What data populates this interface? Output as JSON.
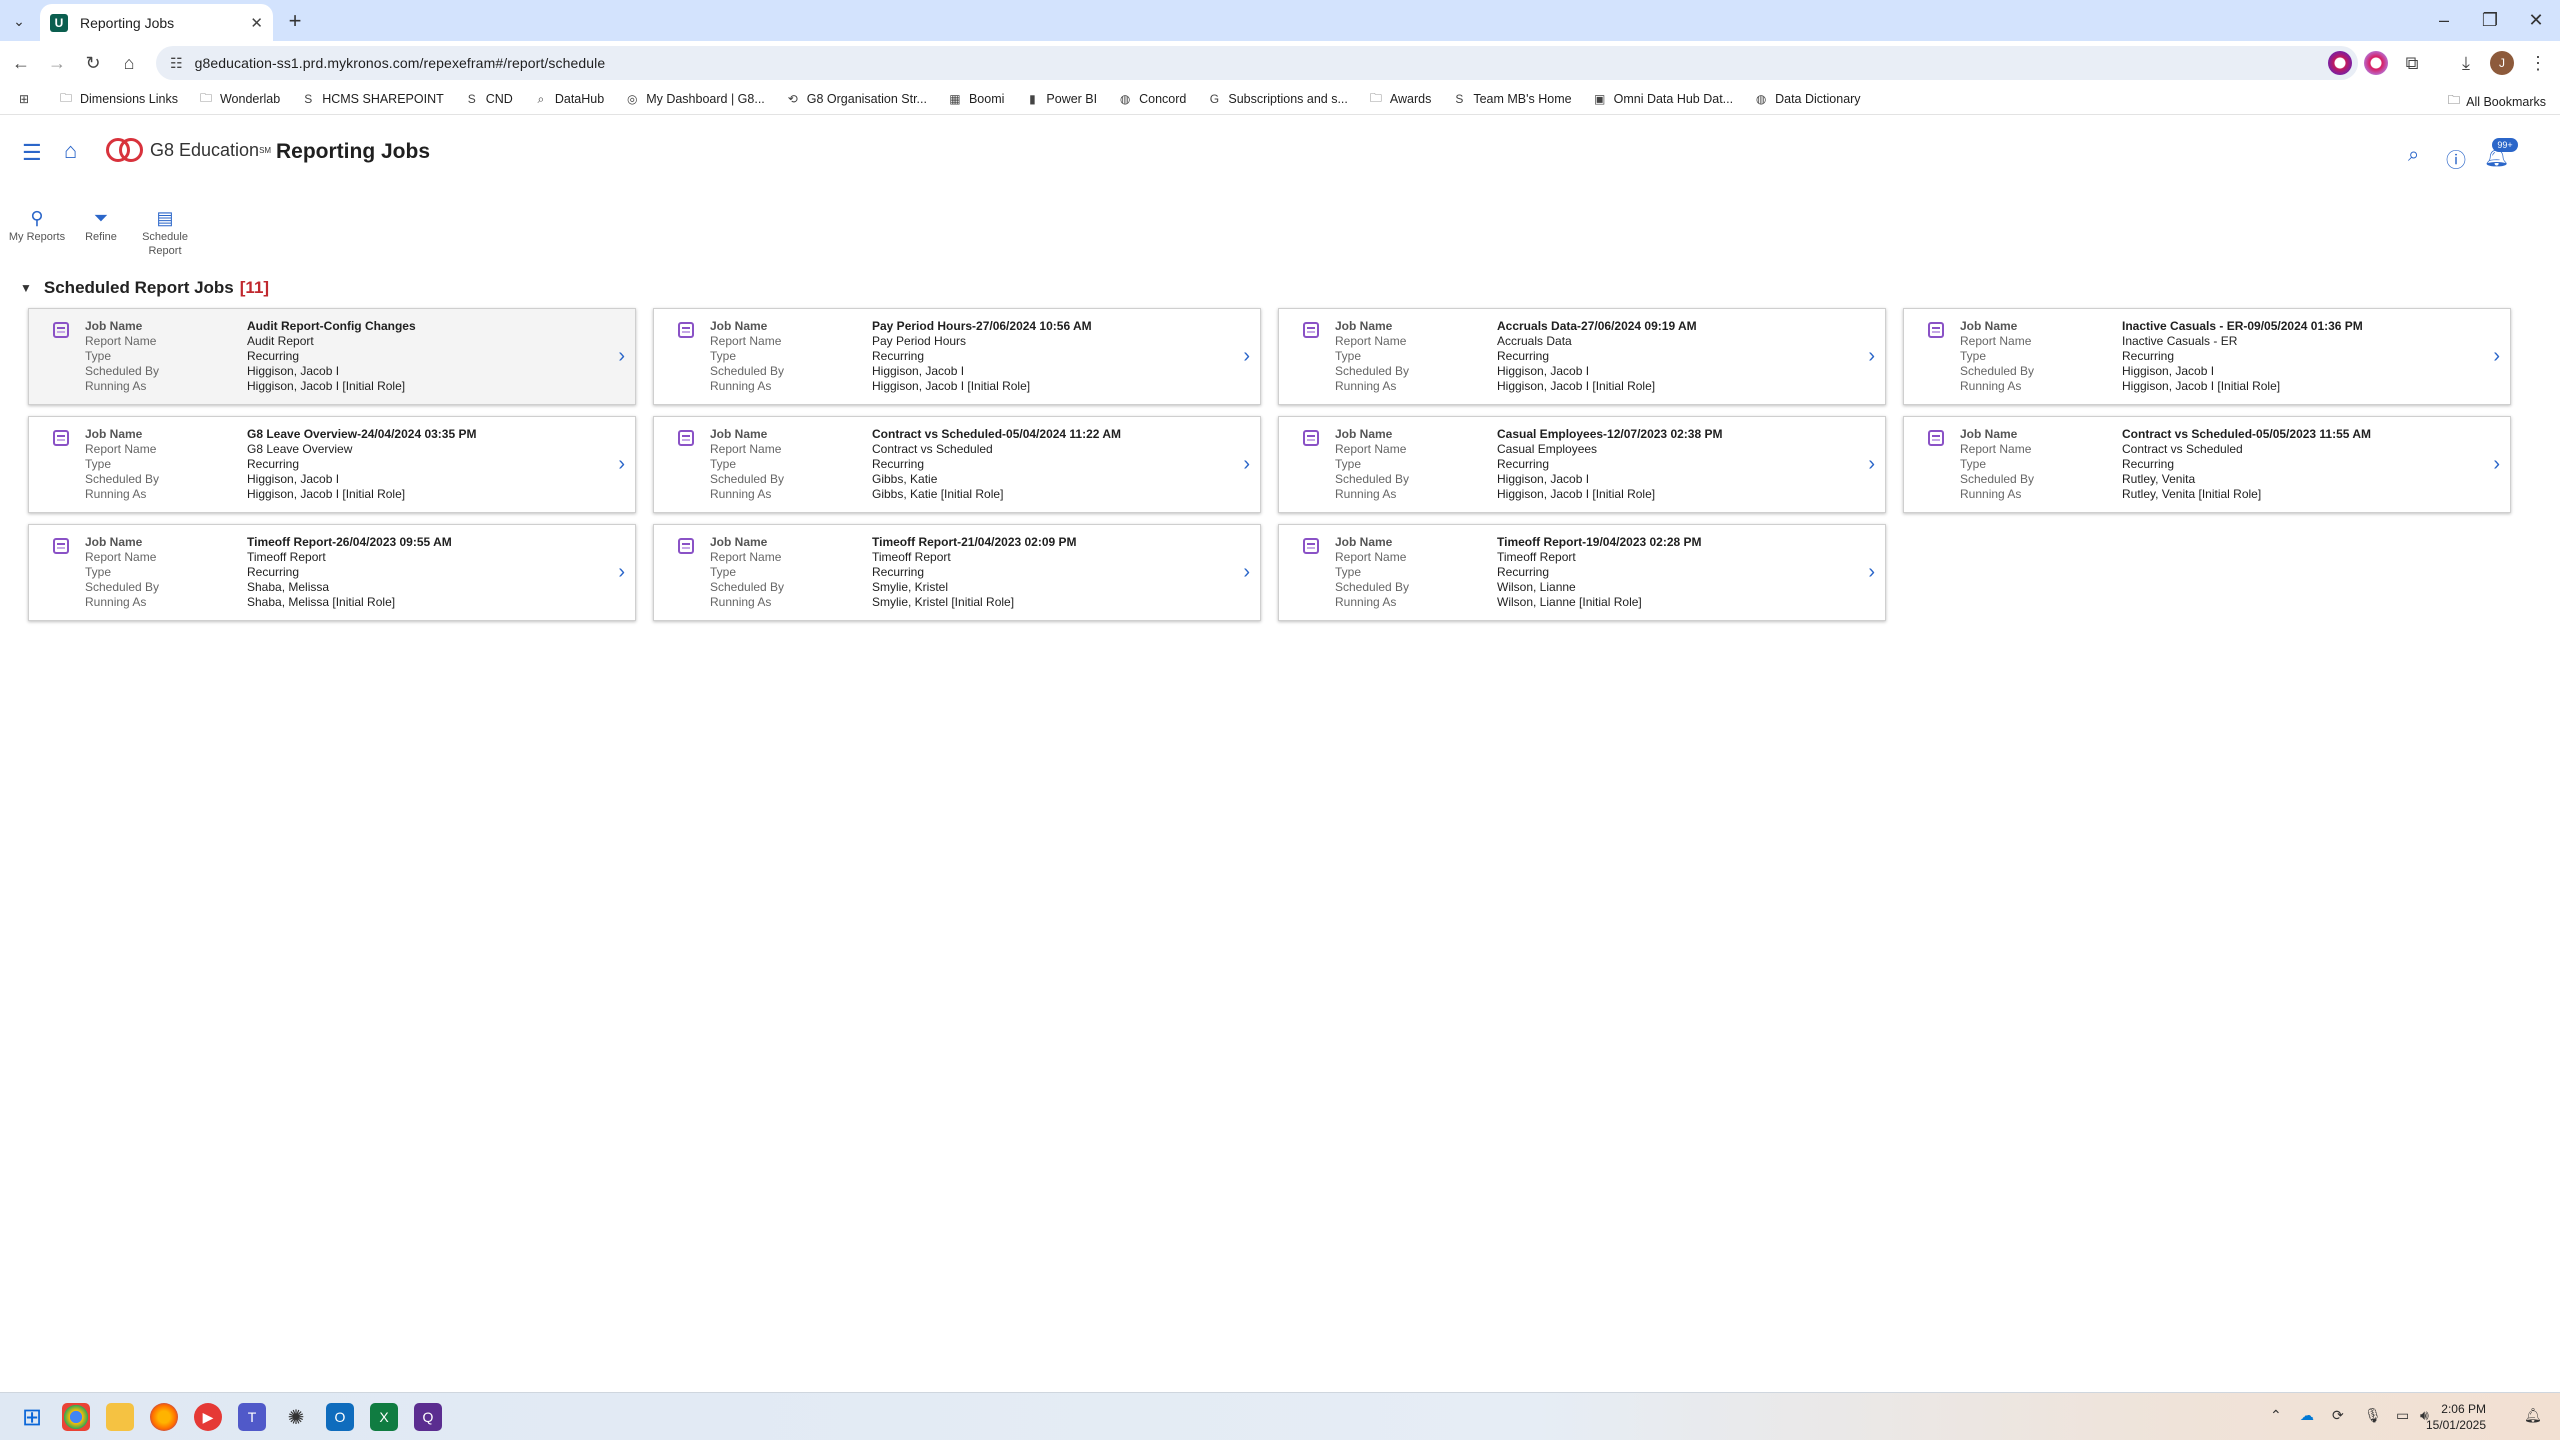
{
  "browser": {
    "tab_title": "Reporting Jobs",
    "url": "g8education-ss1.prd.mykronos.com/repexefram#/report/schedule",
    "profile_initial": "J",
    "bookmarks": [
      {
        "label": "Dimensions Links",
        "icon": "folder-icon"
      },
      {
        "label": "Wonderlab",
        "icon": "folder-icon"
      },
      {
        "label": "HCMS SHAREPOINT",
        "icon": "sharepoint-icon"
      },
      {
        "label": "CND",
        "icon": "sharepoint-icon"
      },
      {
        "label": "DataHub",
        "icon": "search-icon"
      },
      {
        "label": "My Dashboard | G8...",
        "icon": "dashboard-icon"
      },
      {
        "label": "G8 Organisation Str...",
        "icon": "org-icon"
      },
      {
        "label": "Boomi",
        "icon": "grid-icon"
      },
      {
        "label": "Power BI",
        "icon": "powerbi-icon"
      },
      {
        "label": "Concord",
        "icon": "globe-icon"
      },
      {
        "label": "Subscriptions and s...",
        "icon": "google-icon"
      },
      {
        "label": "Awards",
        "icon": "folder-icon"
      },
      {
        "label": "Team MB's Home",
        "icon": "sharepoint-icon"
      },
      {
        "label": "Omni Data Hub Dat...",
        "icon": "document-icon"
      },
      {
        "label": "Data Dictionary",
        "icon": "globe-icon"
      }
    ],
    "all_bookmarks": "All Bookmarks"
  },
  "app": {
    "brand": "G8 Education",
    "brand_mark": "SM",
    "page_title": "Reporting Jobs",
    "notification_count": "99+"
  },
  "actions": [
    {
      "label": "My Reports"
    },
    {
      "label": "Refine"
    },
    {
      "label": "Schedule Report"
    }
  ],
  "section": {
    "title": "Scheduled Report Jobs",
    "count": "[11]"
  },
  "field_labels": {
    "job_name": "Job Name",
    "report_name": "Report Name",
    "type": "Type",
    "scheduled_by": "Scheduled By",
    "running_as": "Running As"
  },
  "jobs": [
    {
      "job_name": "Audit Report-Config Changes",
      "report_name": "Audit Report",
      "type": "Recurring",
      "scheduled_by": "Higgison, Jacob I",
      "running_as": "Higgison, Jacob I [Initial Role]"
    },
    {
      "job_name": "Pay Period Hours-27/06/2024 10:56 AM",
      "report_name": "Pay Period Hours",
      "type": "Recurring",
      "scheduled_by": "Higgison, Jacob I",
      "running_as": "Higgison, Jacob I [Initial Role]"
    },
    {
      "job_name": "Accruals Data-27/06/2024 09:19 AM",
      "report_name": "Accruals Data",
      "type": "Recurring",
      "scheduled_by": "Higgison, Jacob I",
      "running_as": "Higgison, Jacob I [Initial Role]"
    },
    {
      "job_name": "Inactive Casuals - ER-09/05/2024 01:36 PM",
      "report_name": "Inactive Casuals - ER",
      "type": "Recurring",
      "scheduled_by": "Higgison, Jacob I",
      "running_as": "Higgison, Jacob I [Initial Role]"
    },
    {
      "job_name": "G8 Leave Overview-24/04/2024 03:35 PM",
      "report_name": "G8 Leave Overview",
      "type": "Recurring",
      "scheduled_by": "Higgison, Jacob I",
      "running_as": "Higgison, Jacob I [Initial Role]"
    },
    {
      "job_name": "Contract vs Scheduled-05/04/2024 11:22 AM",
      "report_name": "Contract vs Scheduled",
      "type": "Recurring",
      "scheduled_by": "Gibbs, Katie",
      "running_as": "Gibbs, Katie [Initial Role]"
    },
    {
      "job_name": "Casual Employees-12/07/2023 02:38 PM",
      "report_name": "Casual Employees",
      "type": "Recurring",
      "scheduled_by": "Higgison, Jacob I",
      "running_as": "Higgison, Jacob I [Initial Role]"
    },
    {
      "job_name": "Contract vs Scheduled-05/05/2023 11:55 AM",
      "report_name": "Contract vs Scheduled",
      "type": "Recurring",
      "scheduled_by": "Rutley, Venita",
      "running_as": "Rutley, Venita [Initial Role]"
    },
    {
      "job_name": "Timeoff Report-26/04/2023 09:55 AM",
      "report_name": "Timeoff Report",
      "type": "Recurring",
      "scheduled_by": "Shaba, Melissa",
      "running_as": "Shaba, Melissa [Initial Role]"
    },
    {
      "job_name": "Timeoff Report-21/04/2023 02:09 PM",
      "report_name": "Timeoff Report",
      "type": "Recurring",
      "scheduled_by": "Smylie, Kristel",
      "running_as": "Smylie, Kristel [Initial Role]"
    },
    {
      "job_name": "Timeoff Report-19/04/2023 02:28 PM",
      "report_name": "Timeoff Report",
      "type": "Recurring",
      "scheduled_by": "Wilson, Lianne",
      "running_as": "Wilson, Lianne [Initial Role]"
    }
  ],
  "taskbar": {
    "time": "2:06 PM",
    "date": "15/01/2025"
  }
}
